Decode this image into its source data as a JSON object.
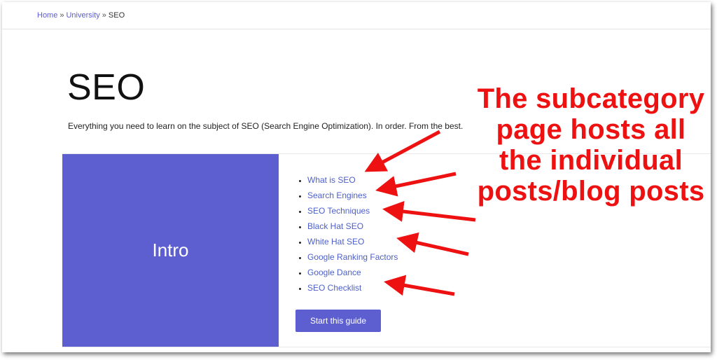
{
  "breadcrumb": {
    "home": "Home",
    "separator": "»",
    "university": "University",
    "current": "SEO"
  },
  "page": {
    "title": "SEO",
    "description": "Everything you need to learn on the subject of SEO (Search Engine Optimization). In order. From the best."
  },
  "card": {
    "intro_label": "Intro",
    "items": [
      {
        "label": "What is SEO"
      },
      {
        "label": "Search Engines"
      },
      {
        "label": "SEO Techniques"
      },
      {
        "label": "Black Hat SEO"
      },
      {
        "label": "White Hat SEO"
      },
      {
        "label": "Google Ranking Factors"
      },
      {
        "label": "Google Dance"
      },
      {
        "label": "SEO Checklist"
      }
    ],
    "start_button": "Start this guide"
  },
  "annotation": {
    "text": "The subcategory page hosts all the individual posts/blog posts",
    "color": "#ee1111"
  },
  "colors": {
    "accent": "#5d5fd1",
    "link": "#4d5fc9"
  }
}
